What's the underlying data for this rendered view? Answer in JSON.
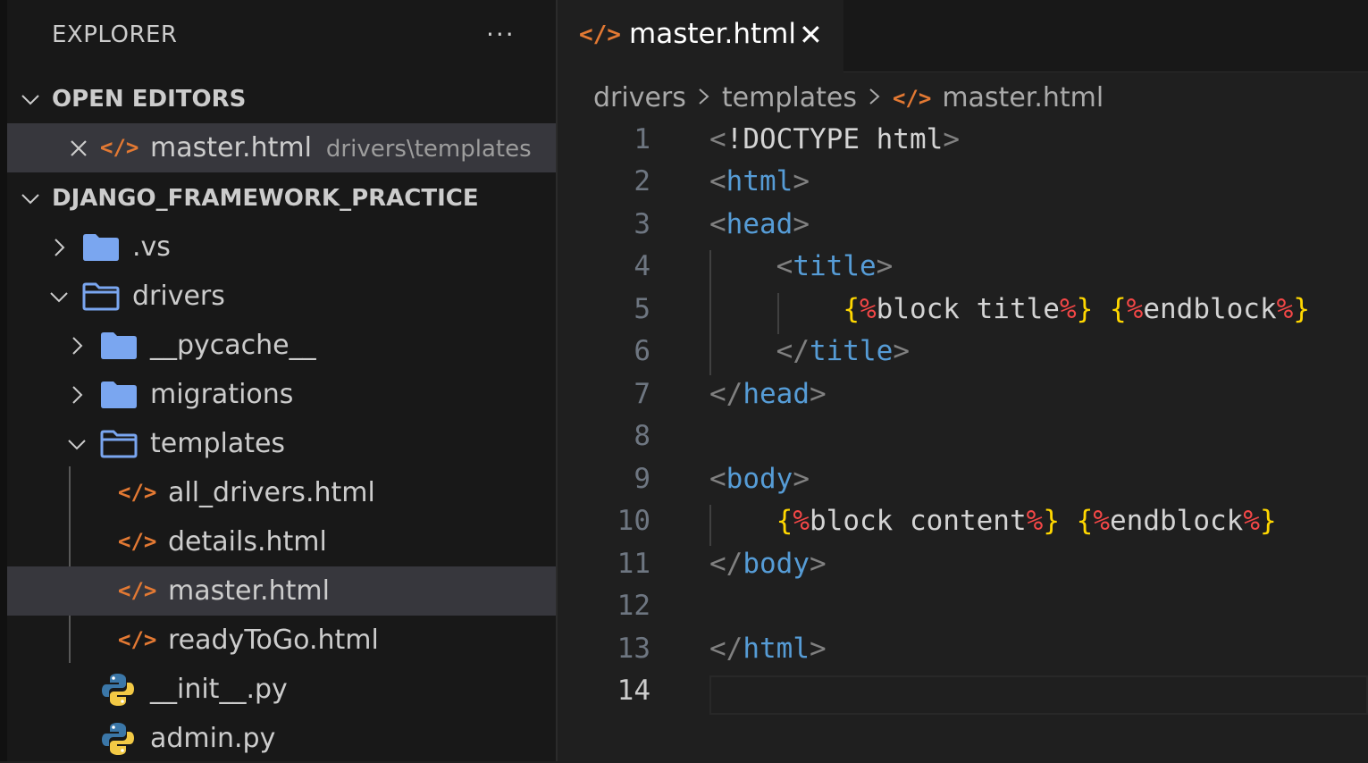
{
  "explorer": {
    "title": "EXPLORER",
    "more": "···",
    "open_editors": {
      "header": "OPEN EDITORS",
      "items": [
        {
          "name": "master.html",
          "description": "drivers\\templates"
        }
      ]
    },
    "project": {
      "header": "DJANGO_FRAMEWORK_PRACTICE",
      "items": [
        {
          "name": ".vs"
        },
        {
          "name": "drivers"
        },
        {
          "name": "__pycache__"
        },
        {
          "name": "migrations"
        },
        {
          "name": "templates"
        },
        {
          "name": "all_drivers.html"
        },
        {
          "name": "details.html"
        },
        {
          "name": "master.html"
        },
        {
          "name": "readyToGo.html"
        },
        {
          "name": "__init__.py"
        },
        {
          "name": "admin.py"
        }
      ]
    }
  },
  "tab": {
    "label": "master.html",
    "close": "✕"
  },
  "breadcrumb": [
    "drivers",
    "templates",
    "master.html"
  ],
  "editor": {
    "active_line": 14,
    "line_numbers": [
      "1",
      "2",
      "3",
      "4",
      "5",
      "6",
      "7",
      "8",
      "9",
      "10",
      "11",
      "12",
      "13",
      "14"
    ]
  },
  "colors": {
    "accent_html_icon": "#e37933",
    "python_blue": "#3b77a8",
    "python_yellow": "#f2c945",
    "folder": "#7aa6f0"
  }
}
